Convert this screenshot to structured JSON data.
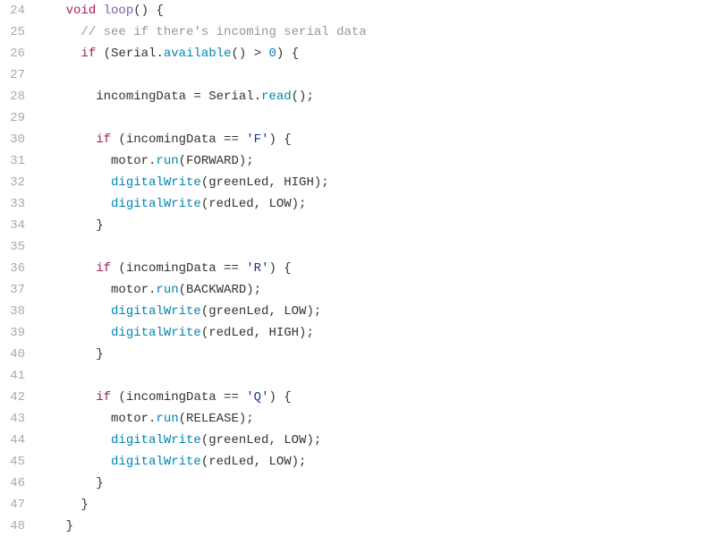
{
  "startLine": 24,
  "lines": [
    {
      "n": 24,
      "indent": 2,
      "tokens": [
        {
          "t": "void",
          "c": "kw"
        },
        {
          "t": " "
        },
        {
          "t": "loop",
          "c": "fn"
        },
        {
          "t": "() {"
        }
      ]
    },
    {
      "n": 25,
      "indent": 3,
      "tokens": [
        {
          "t": "// see if there's incoming serial data",
          "c": "cmt"
        }
      ]
    },
    {
      "n": 26,
      "indent": 3,
      "tokens": [
        {
          "t": "if",
          "c": "kw"
        },
        {
          "t": " (Serial."
        },
        {
          "t": "available",
          "c": "call"
        },
        {
          "t": "() > "
        },
        {
          "t": "0",
          "c": "num"
        },
        {
          "t": ") {"
        }
      ]
    },
    {
      "n": 27,
      "indent": 0,
      "tokens": []
    },
    {
      "n": 28,
      "indent": 4,
      "tokens": [
        {
          "t": "incomingData = Serial."
        },
        {
          "t": "read",
          "c": "call"
        },
        {
          "t": "();"
        }
      ]
    },
    {
      "n": 29,
      "indent": 0,
      "tokens": []
    },
    {
      "n": 30,
      "indent": 4,
      "tokens": [
        {
          "t": "if",
          "c": "kw"
        },
        {
          "t": " (incomingData == "
        },
        {
          "t": "'F'",
          "c": "str"
        },
        {
          "t": ") {"
        }
      ]
    },
    {
      "n": 31,
      "indent": 5,
      "tokens": [
        {
          "t": "motor."
        },
        {
          "t": "run",
          "c": "call"
        },
        {
          "t": "(FORWARD);"
        }
      ]
    },
    {
      "n": 32,
      "indent": 5,
      "tokens": [
        {
          "t": "digitalWrite",
          "c": "call"
        },
        {
          "t": "(greenLed, HIGH);"
        }
      ]
    },
    {
      "n": 33,
      "indent": 5,
      "tokens": [
        {
          "t": "digitalWrite",
          "c": "call"
        },
        {
          "t": "(redLed, LOW);"
        }
      ]
    },
    {
      "n": 34,
      "indent": 4,
      "tokens": [
        {
          "t": "}"
        }
      ]
    },
    {
      "n": 35,
      "indent": 0,
      "tokens": []
    },
    {
      "n": 36,
      "indent": 4,
      "tokens": [
        {
          "t": "if",
          "c": "kw"
        },
        {
          "t": " (incomingData == "
        },
        {
          "t": "'R'",
          "c": "str"
        },
        {
          "t": ") {"
        }
      ]
    },
    {
      "n": 37,
      "indent": 5,
      "tokens": [
        {
          "t": "motor."
        },
        {
          "t": "run",
          "c": "call"
        },
        {
          "t": "(BACKWARD);"
        }
      ]
    },
    {
      "n": 38,
      "indent": 5,
      "tokens": [
        {
          "t": "digitalWrite",
          "c": "call"
        },
        {
          "t": "(greenLed, LOW);"
        }
      ]
    },
    {
      "n": 39,
      "indent": 5,
      "tokens": [
        {
          "t": "digitalWrite",
          "c": "call"
        },
        {
          "t": "(redLed, HIGH);"
        }
      ]
    },
    {
      "n": 40,
      "indent": 4,
      "tokens": [
        {
          "t": "}"
        }
      ]
    },
    {
      "n": 41,
      "indent": 0,
      "tokens": []
    },
    {
      "n": 42,
      "indent": 4,
      "tokens": [
        {
          "t": "if",
          "c": "kw"
        },
        {
          "t": " (incomingData == "
        },
        {
          "t": "'Q'",
          "c": "str"
        },
        {
          "t": ") {"
        }
      ]
    },
    {
      "n": 43,
      "indent": 5,
      "tokens": [
        {
          "t": "motor."
        },
        {
          "t": "run",
          "c": "call"
        },
        {
          "t": "(RELEASE);"
        }
      ]
    },
    {
      "n": 44,
      "indent": 5,
      "tokens": [
        {
          "t": "digitalWrite",
          "c": "call"
        },
        {
          "t": "(greenLed, LOW);"
        }
      ]
    },
    {
      "n": 45,
      "indent": 5,
      "tokens": [
        {
          "t": "digitalWrite",
          "c": "call"
        },
        {
          "t": "(redLed, LOW);"
        }
      ]
    },
    {
      "n": 46,
      "indent": 4,
      "tokens": [
        {
          "t": "}"
        }
      ]
    },
    {
      "n": 47,
      "indent": 3,
      "tokens": [
        {
          "t": "}"
        }
      ]
    },
    {
      "n": 48,
      "indent": 2,
      "tokens": [
        {
          "t": "}"
        }
      ]
    }
  ]
}
